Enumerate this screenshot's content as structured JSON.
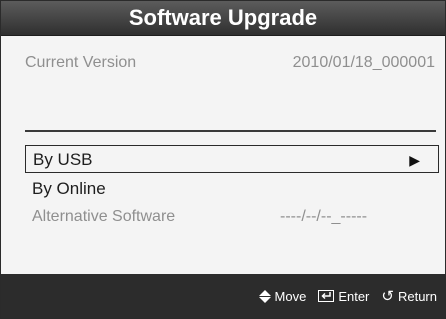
{
  "dialog": {
    "title": "Software Upgrade",
    "current_version": {
      "label": "Current Version",
      "value": "2010/01/18_000001"
    },
    "menu": [
      {
        "label": "By USB",
        "selected": true,
        "arrow": "▶"
      },
      {
        "label": "By Online",
        "selected": false
      }
    ],
    "alternative": {
      "label": "Alternative Software",
      "value": "----/--/--_-----"
    }
  },
  "footer": {
    "move_label": "Move",
    "enter_label": "Enter",
    "return_label": "Return",
    "return_glyph": "↺"
  },
  "icons": {
    "move": "up-down-arrows-icon",
    "enter": "enter-icon",
    "return": "return-icon",
    "submenu": "right-arrow-icon"
  },
  "colors": {
    "title_bar": "#3a3a3a",
    "panel_bg": "#f4f4f4",
    "muted_text": "#8f8f8f",
    "footer_bg": "#2c2c2c"
  }
}
